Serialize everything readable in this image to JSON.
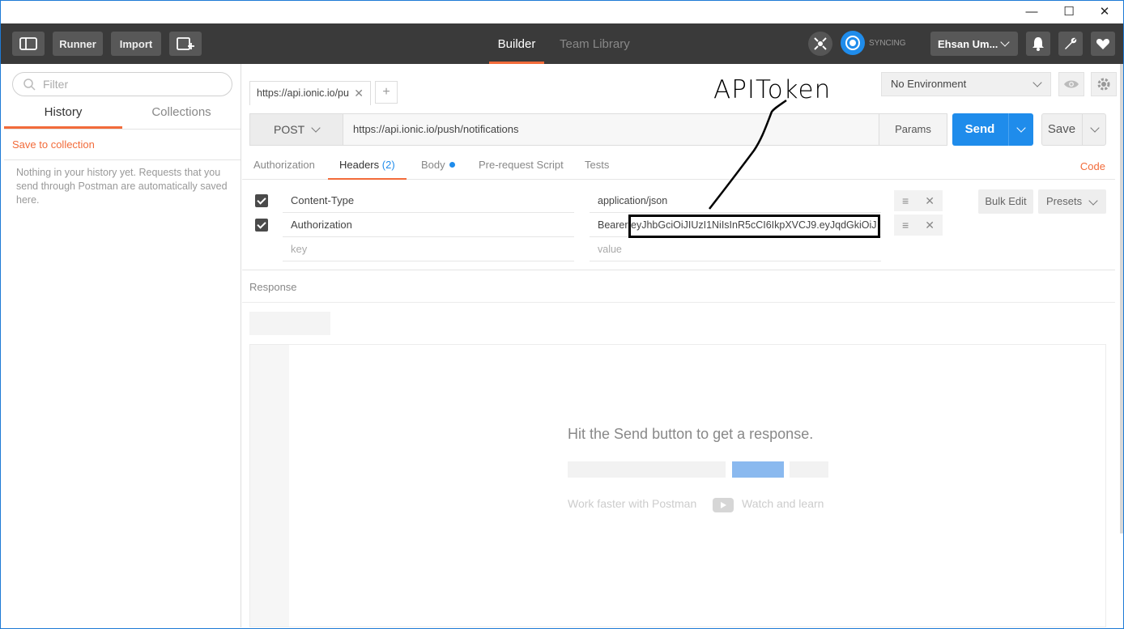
{
  "window": {
    "min": "—",
    "max": "☐",
    "close": "✕"
  },
  "toolbar": {
    "runner": "Runner",
    "import": "Import",
    "nav_builder": "Builder",
    "nav_team_library": "Team Library",
    "sync_status": "SYNCING",
    "user": "Ehsan Um..."
  },
  "sidebar": {
    "filter_placeholder": "Filter",
    "tabs": [
      "History",
      "Collections"
    ],
    "save_to_collection": "Save to collection",
    "empty_text": "Nothing in your history yet. Requests that you send through Postman are automatically saved here."
  },
  "request": {
    "tab_title": "https://api.ionic.io/pu",
    "method": "POST",
    "url": "https://api.ionic.io/push/notifications",
    "params": "Params",
    "send": "Send",
    "save": "Save",
    "environment": "No Environment"
  },
  "subtabs": {
    "authorization": "Authorization",
    "headers": "Headers",
    "headers_count": "(2)",
    "body": "Body",
    "prerequest": "Pre-request Script",
    "tests": "Tests",
    "code": "Code"
  },
  "headers": [
    {
      "key": "Content-Type",
      "value": "application/json"
    },
    {
      "key": "Authorization",
      "value": "Bearer eyJhbGciOiJIUzI1NiIsInR5cCI6IkpXVCJ9.eyJqdGkiOiJ"
    }
  ],
  "header_placeholders": {
    "key": "key",
    "value": "value"
  },
  "header_actions": {
    "bulk_edit": "Bulk Edit",
    "presets": "Presets"
  },
  "response": {
    "label": "Response",
    "hint": "Hit the Send button to get a response.",
    "work_faster": "Work faster with Postman",
    "watch": "Watch and learn"
  },
  "annotation": {
    "text": "APIToken"
  },
  "colors": {
    "accent": "#f26b3a",
    "send_blue": "#1f8ceb",
    "topbar": "#3a3a3a"
  }
}
